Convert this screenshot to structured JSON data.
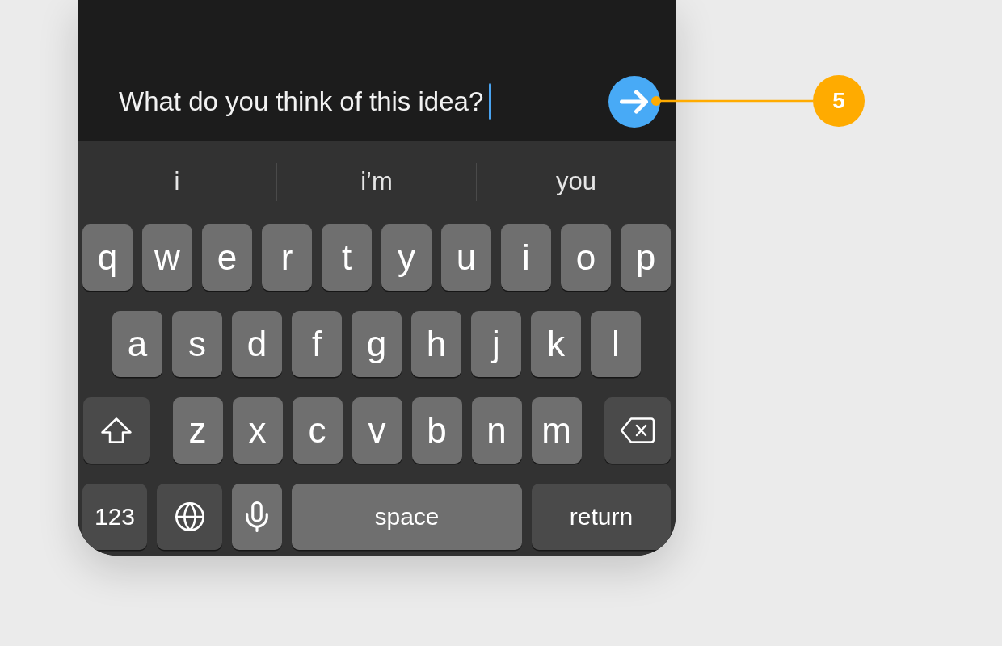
{
  "composer": {
    "text": "What do you think of this idea?",
    "focused": true
  },
  "suggestions": [
    "i",
    "i’m",
    "you"
  ],
  "keyboard": {
    "top_letters": [
      {
        "kind": "letter",
        "label": "q"
      },
      {
        "kind": "letter",
        "label": "w"
      },
      {
        "kind": "letter",
        "label": "e"
      },
      {
        "kind": "letter",
        "label": "r"
      },
      {
        "kind": "letter",
        "label": "t"
      },
      {
        "kind": "letter",
        "label": "y"
      },
      {
        "kind": "letter",
        "label": "u"
      },
      {
        "kind": "letter",
        "label": "i"
      },
      {
        "kind": "letter",
        "label": "o"
      },
      {
        "kind": "letter",
        "label": "p"
      }
    ],
    "middle_letters": [
      {
        "kind": "letter",
        "label": "a"
      },
      {
        "kind": "letter",
        "label": "s"
      },
      {
        "kind": "letter",
        "label": "d"
      },
      {
        "kind": "letter",
        "label": "f"
      },
      {
        "kind": "letter",
        "label": "g"
      },
      {
        "kind": "letter",
        "label": "h"
      },
      {
        "kind": "letter",
        "label": "j"
      },
      {
        "kind": "letter",
        "label": "k"
      },
      {
        "kind": "letter",
        "label": "l"
      }
    ],
    "bottom_letters": [
      {
        "kind": "shift"
      },
      {
        "kind": "letter",
        "label": "z"
      },
      {
        "kind": "letter",
        "label": "x"
      },
      {
        "kind": "letter",
        "label": "c"
      },
      {
        "kind": "letter",
        "label": "v"
      },
      {
        "kind": "letter",
        "label": "b"
      },
      {
        "kind": "letter",
        "label": "n"
      },
      {
        "kind": "letter",
        "label": "m"
      },
      {
        "kind": "delete"
      }
    ],
    "function_keys": [
      {
        "kind": "numbers",
        "label": "123"
      },
      {
        "kind": "globe"
      },
      {
        "kind": "mic"
      },
      {
        "kind": "space",
        "label": "space"
      },
      {
        "kind": "return",
        "label": "return"
      }
    ]
  },
  "annotation": {
    "label": "5"
  }
}
